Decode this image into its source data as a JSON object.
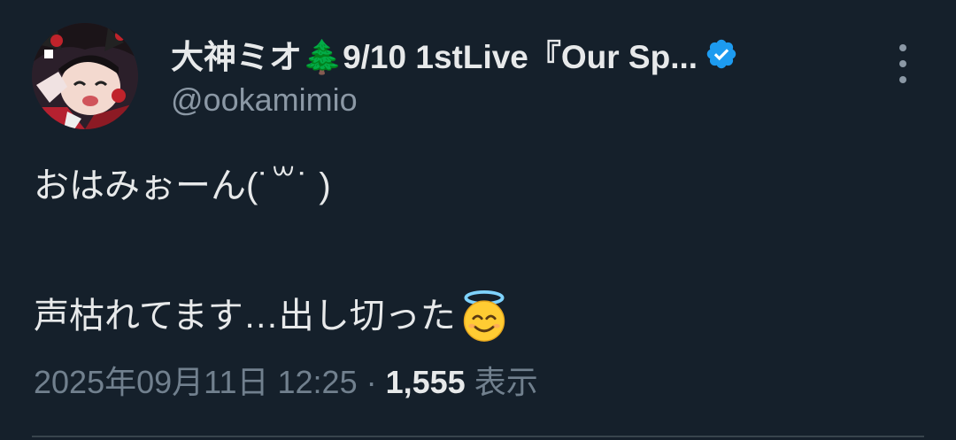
{
  "tweet": {
    "author": {
      "display_name": "大神ミオ🌲9/10 1stLive『Our Sp...",
      "handle": "@ookamimio",
      "verified": true,
      "verified_icon": "verified-badge-icon",
      "verified_color": "#1d9bf0"
    },
    "text_line1": "おはみぉーん(˙꒳˙ )",
    "text_line2": "声枯れてます…出し切った",
    "text_line2_emoji": "smiling-face-with-halo",
    "timestamp": "2025年09月11日 12:25",
    "separator": "·",
    "views_count": "1,555",
    "views_label": "表示"
  },
  "colors": {
    "background": "#15202b",
    "text_primary": "#e7e9ea",
    "text_secondary": "#8b98a5",
    "accent": "#1d9bf0"
  }
}
